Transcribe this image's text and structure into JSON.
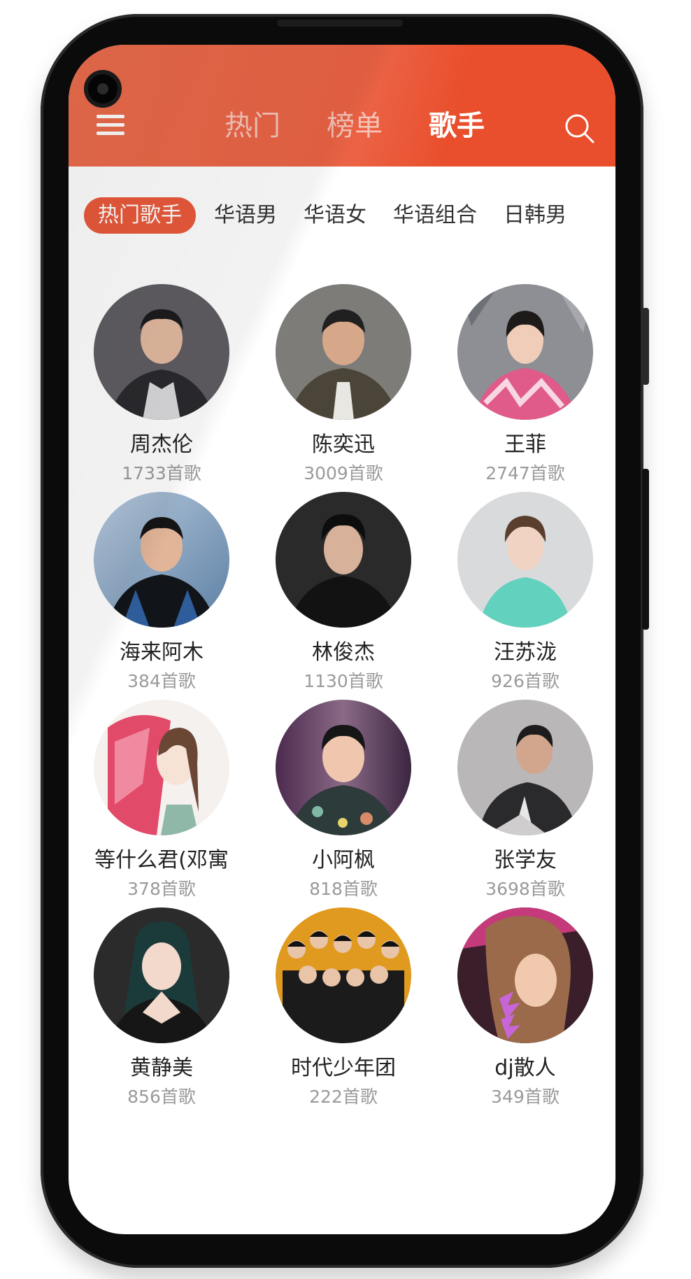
{
  "header": {
    "tabs": [
      {
        "label": "热门",
        "active": false
      },
      {
        "label": "榜单",
        "active": false
      },
      {
        "label": "歌手",
        "active": true
      }
    ],
    "menu_icon": "hamburger-menu-icon",
    "search_icon": "search-icon",
    "accent_color": "#eb5a3b"
  },
  "categories": [
    {
      "label": "热门歌手",
      "active": true
    },
    {
      "label": "华语男",
      "active": false
    },
    {
      "label": "华语女",
      "active": false
    },
    {
      "label": "华语组合",
      "active": false
    },
    {
      "label": "日韩男",
      "active": false
    }
  ],
  "artists": [
    {
      "name": "周杰伦",
      "count": "1733首歌"
    },
    {
      "name": "陈奕迅",
      "count": "3009首歌"
    },
    {
      "name": "王菲",
      "count": "2747首歌"
    },
    {
      "name": "海来阿木",
      "count": "384首歌"
    },
    {
      "name": "林俊杰",
      "count": "1130首歌"
    },
    {
      "name": "汪苏泷",
      "count": "926首歌"
    },
    {
      "name": "等什么君(邓寓",
      "count": "378首歌"
    },
    {
      "name": "小阿枫",
      "count": "818首歌"
    },
    {
      "name": "张学友",
      "count": "3698首歌"
    },
    {
      "name": "黄静美",
      "count": "856首歌"
    },
    {
      "name": "时代少年团",
      "count": "222首歌"
    },
    {
      "name": "dj散人",
      "count": "349首歌"
    }
  ]
}
